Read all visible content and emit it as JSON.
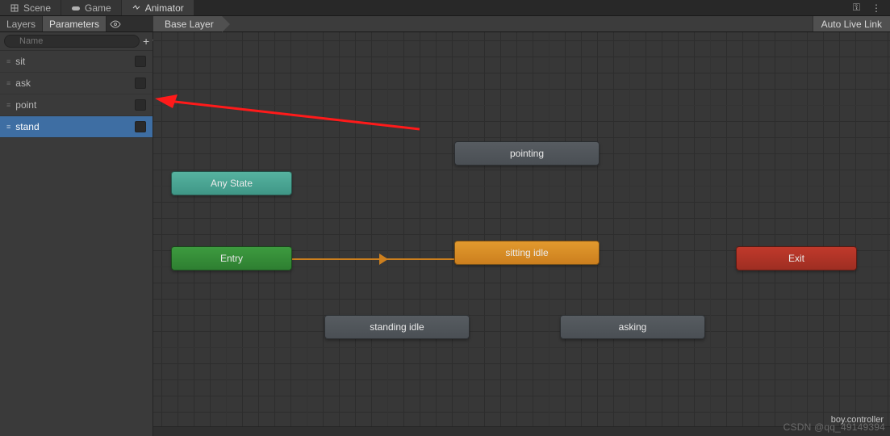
{
  "tabs": {
    "scene": "Scene",
    "game": "Game",
    "animator": "Animator"
  },
  "toolbar": {
    "layers": "Layers",
    "parameters": "Parameters",
    "breadcrumb": "Base Layer",
    "autoLiveLink": "Auto Live Link"
  },
  "search": {
    "placeholder": "Name"
  },
  "params": [
    {
      "name": "sit",
      "selected": false
    },
    {
      "name": "ask",
      "selected": false
    },
    {
      "name": "point",
      "selected": false
    },
    {
      "name": "stand",
      "selected": true
    }
  ],
  "nodes": {
    "anyState": "Any State",
    "entry": "Entry",
    "exit": "Exit",
    "pointing": "pointing",
    "sittingIdle": "sitting idle",
    "standingIdle": "standing idle",
    "asking": "asking"
  },
  "footer": {
    "file": "boy.controller"
  },
  "watermark": "CSDN @qq_49149394"
}
